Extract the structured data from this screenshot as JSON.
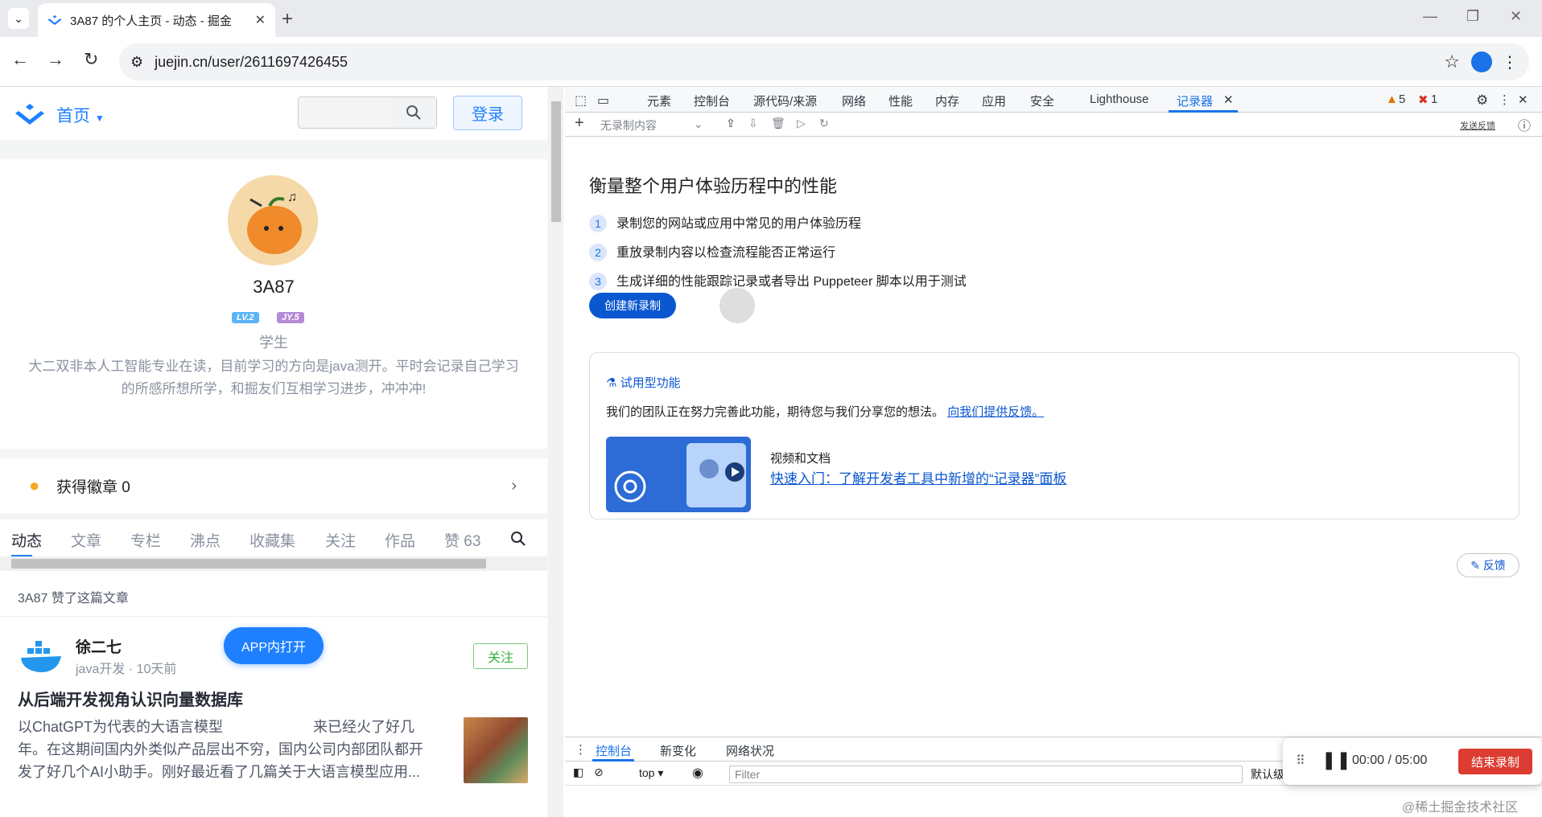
{
  "browser": {
    "tab_title": "3A87 的个人主页 - 动态 - 掘金",
    "url": "juejin.cn/user/2611697426455"
  },
  "site": {
    "home_label": "首页",
    "login_label": "登录"
  },
  "profile": {
    "name": "3A87",
    "level_badge": "LV.2",
    "jy_badge": "JY.5",
    "role": "学生",
    "bio": "大二双非本人工智能专业在读，目前学习的方向是java测开。平时会记录自己学习的所感所想所学，和掘友们互相学习进步，冲冲冲!",
    "badges_label": "获得徽章 0"
  },
  "profile_tabs": [
    "动态",
    "文章",
    "专栏",
    "沸点",
    "收藏集",
    "关注",
    "作品",
    "赞 63"
  ],
  "feed": {
    "liked_text": "3A87 赞了这篇文章",
    "author": "徐二七",
    "author_meta": "java开发 · 10天前",
    "follow_label": "关注",
    "title": "从后端开发视角认识向量数据库",
    "body_line1": "以ChatGPT为代表的大语言模型",
    "body_line1b": "来已经火了好几",
    "body_line2": "年。在这期间国内外类似产品层出不穷，国内公司内部团队都开",
    "body_line3": "发了好几个AI小助手。刚好最近看了几篇关于大语言模型应用...",
    "app_open_label": "APP内打开"
  },
  "devtools": {
    "tabs": [
      "元素",
      "控制台",
      "源代码/来源",
      "网络",
      "性能",
      "内存",
      "应用",
      "安全",
      "Lighthouse",
      "记录器"
    ],
    "warnings": "5",
    "errors": "1",
    "recording_select": "无录制内容",
    "send_feedback": "发送反馈",
    "heading": "衡量整个用户体验历程中的性能",
    "steps": [
      {
        "n": "1",
        "text": "录制您的网站或应用中常见的用户体验历程"
      },
      {
        "n": "2",
        "text": "重放录制内容以检查流程能否正常运行"
      },
      {
        "n": "3",
        "text": "生成详细的性能跟踪记录或者导出 Puppeteer 脚本以用于测试"
      }
    ],
    "create_label": "创建新录制",
    "experimental_title": "试用型功能",
    "experimental_desc": "我们的团队正在努力完善此功能，期待您与我们分享您的想法。",
    "experimental_link": "向我们提供反馈。",
    "video_label": "视频和文档",
    "video_link": "快速入门：了解开发者工具中新增的“记录器”面板",
    "feedback_label": "反馈",
    "drawer_tabs": [
      "控制台",
      "新变化",
      "网络状况"
    ],
    "context": "top",
    "filter_placeholder": "Filter",
    "default_levels": "默认级"
  },
  "recorder": {
    "time": "00:00 / 05:00",
    "stop_label": "结束录制"
  },
  "watermark": "@稀土掘金技术社区"
}
